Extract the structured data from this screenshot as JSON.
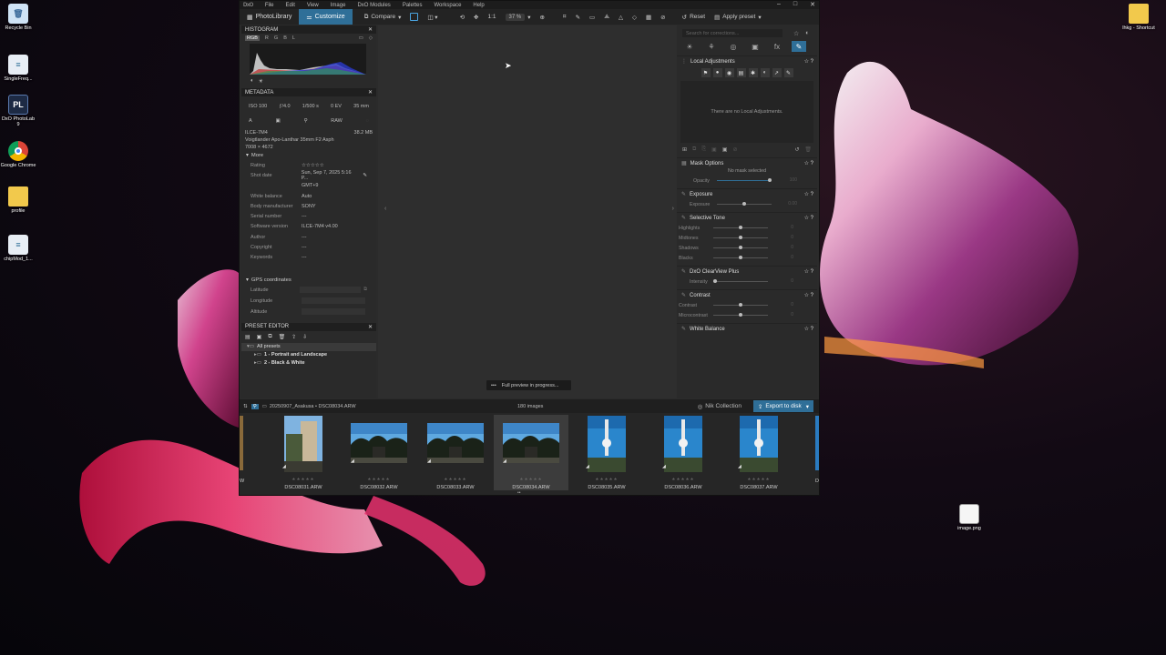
{
  "desktop": {
    "icons": [
      {
        "label": "Recycle Bin"
      },
      {
        "label": "SingleFreq..."
      },
      {
        "label": "DxO PhotoLab 9"
      },
      {
        "label": "Google Chrome"
      },
      {
        "label": "profile"
      },
      {
        "label": "chipMod_1..."
      },
      {
        "label": "lhkg - Shortcut"
      },
      {
        "label": "image.png"
      }
    ]
  },
  "menu": [
    "File",
    "Edit",
    "View",
    "Image",
    "DxO Modules",
    "Palettes",
    "Workspace",
    "Help"
  ],
  "toolbar": {
    "photolibrary": "PhotoLibrary",
    "customize": "Customize",
    "compare": "Compare",
    "ratio": "1:1",
    "zoom": "37 %",
    "reset": "Reset",
    "apply_preset": "Apply preset"
  },
  "histogram": {
    "title": "HISTOGRAM",
    "channels": [
      "RGB",
      "R",
      "G",
      "B",
      "L"
    ]
  },
  "metadata": {
    "title": "METADATA",
    "iso": "ISO 100",
    "aperture": "ƒ/4.0",
    "shutter": "1/500 s",
    "ev": "0 EV",
    "focal": "35 mm",
    "mode": "A",
    "format": "RAW",
    "camera": "ILCE-7M4",
    "size": "38.2 MB",
    "lens": "Voigtlander Apo-Lanthar 35mm F2 Asph",
    "dimensions": "7008 × 4672",
    "more": "More",
    "fields": [
      {
        "k": "Rating",
        "v": "☆☆☆☆☆"
      },
      {
        "k": "Shot date",
        "v": "Sun, Sep 7, 2025 5:16 P..."
      },
      {
        "k": "",
        "v": "GMT+9"
      },
      {
        "k": "White balance",
        "v": "Auto"
      },
      {
        "k": "Body manufacturer",
        "v": "SONY"
      },
      {
        "k": "Serial number",
        "v": "---"
      },
      {
        "k": "Software version",
        "v": "ILCE-7M4 v4.00"
      },
      {
        "k": "Author",
        "v": "---"
      },
      {
        "k": "Copyright",
        "v": "---"
      },
      {
        "k": "Keywords",
        "v": "---"
      }
    ],
    "gps_title": "GPS coordinates",
    "gps": [
      {
        "k": "Latitude"
      },
      {
        "k": "Longitude"
      },
      {
        "k": "Altitude"
      }
    ]
  },
  "preset_editor": {
    "title": "PRESET EDITOR",
    "items": [
      "All presets",
      "1 - Portrait and Landscape",
      "2 - Black & White"
    ]
  },
  "viewer": {
    "toast": "Full preview in progress..."
  },
  "right": {
    "search_placeholder": "Search for corrections...",
    "local_adjustments": "Local Adjustments",
    "no_local": "There are no Local Adjustments.",
    "mask_options": "Mask Options",
    "no_mask": "No mask selected",
    "opacity": "Opacity",
    "opacity_val": "100",
    "exposure_title": "Exposure",
    "exposure": "Exposure",
    "exposure_val": "0.00",
    "selective_tone": "Selective Tone",
    "tones": [
      "Highlights",
      "Midtones",
      "Shadows",
      "Blacks"
    ],
    "clearview": "DxO ClearView Plus",
    "intensity": "Intensity",
    "contrast_title": "Contrast",
    "contrast": "Contrast",
    "microcontrast": "Microcontrast",
    "white_balance": "White Balance"
  },
  "filmbar": {
    "path": "20250907_Asakusa • DSC08034.ARW",
    "count": "180 images",
    "nik": "Nik Collection",
    "export": "Export to disk"
  },
  "thumbnails": [
    {
      "name": "DSC08031.ARW",
      "kind": "portrait-street"
    },
    {
      "name": "DSC08032.ARW",
      "kind": "landscape-trees"
    },
    {
      "name": "DSC08033.ARW",
      "kind": "landscape-trees"
    },
    {
      "name": "DSC08034.ARW",
      "kind": "landscape-trees",
      "selected": true
    },
    {
      "name": "DSC08035.ARW",
      "kind": "portrait-tower"
    },
    {
      "name": "DSC08036.ARW",
      "kind": "portrait-tower"
    },
    {
      "name": "DSC08037.ARW",
      "kind": "portrait-tower"
    }
  ],
  "film_edge_left": "W",
  "film_edge_right": "D"
}
